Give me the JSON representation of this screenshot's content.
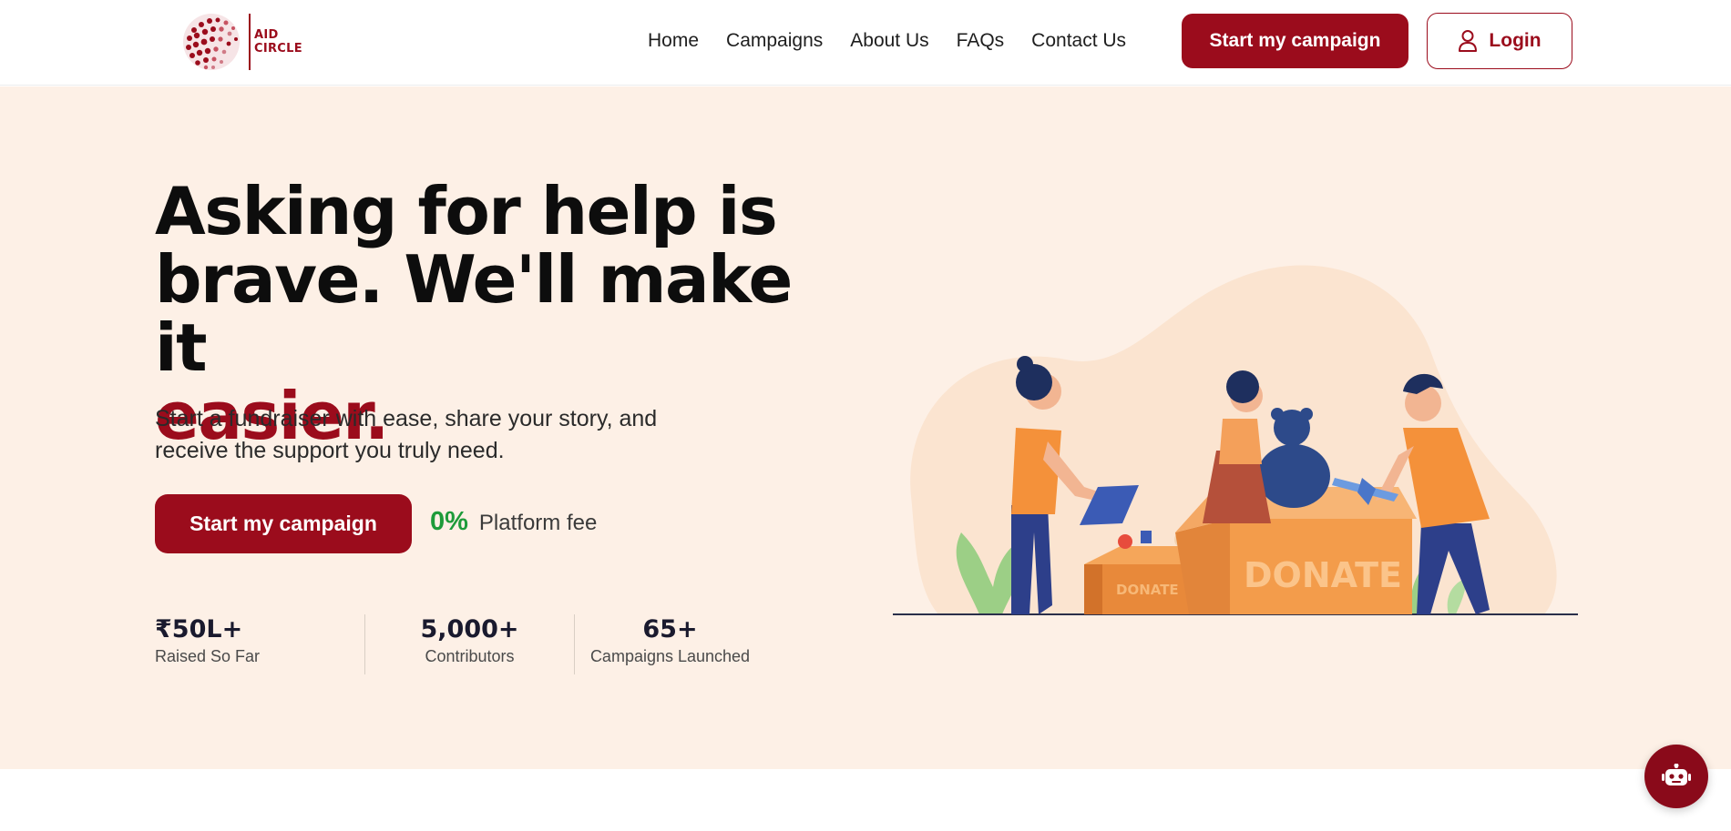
{
  "brand": {
    "line1": "AID",
    "line2": "CIRCLE",
    "color": "#9b0c1c"
  },
  "nav": {
    "items": [
      "Home",
      "Campaigns",
      "About Us",
      "FAQs",
      "Contact Us"
    ]
  },
  "header": {
    "cta_label": "Start my campaign",
    "login_label": "Login"
  },
  "hero": {
    "headline_line1": "Asking for help is",
    "headline_line2": "brave. We'll make it",
    "headline_accent": "easier.",
    "subtext": "Start a fundraiser with ease, share your story, and receive the support you truly need.",
    "cta_label": "Start my campaign",
    "fee_value": "0%",
    "fee_label": "Platform fee",
    "illustration_box_label": "DONATE"
  },
  "stats": [
    {
      "value": "₹50L+",
      "label": "Raised So Far"
    },
    {
      "value": "5,000+",
      "label": "Contributors"
    },
    {
      "value": "65+",
      "label": "Campaigns Launched"
    }
  ],
  "colors": {
    "accent": "#9b0c1c",
    "hero_bg": "#fdf0e6",
    "fee_green": "#1d9b3a"
  },
  "chat": {
    "icon": "robot-icon"
  }
}
